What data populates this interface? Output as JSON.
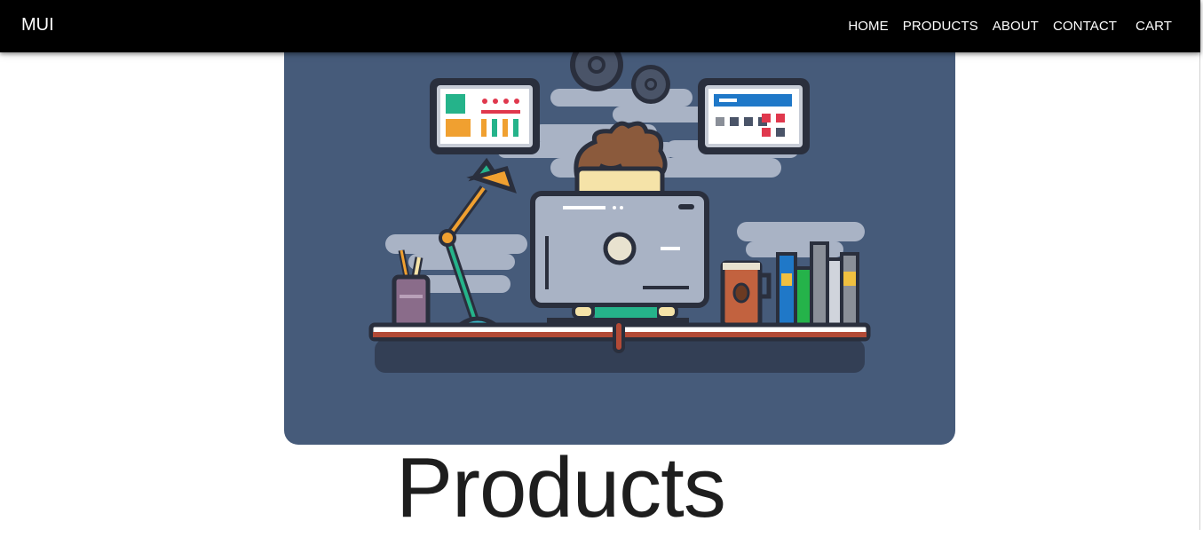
{
  "appbar": {
    "brand": "MUI",
    "nav": [
      {
        "label": "HOME"
      },
      {
        "label": "PRODUCTS"
      },
      {
        "label": "ABOUT"
      },
      {
        "label": "CONTACT"
      },
      {
        "label": "CART"
      }
    ],
    "background": "#000000"
  },
  "hero": {
    "illustration": "developer-at-desk-illustration",
    "background": "#465b7a"
  },
  "main": {
    "title": "Products"
  }
}
